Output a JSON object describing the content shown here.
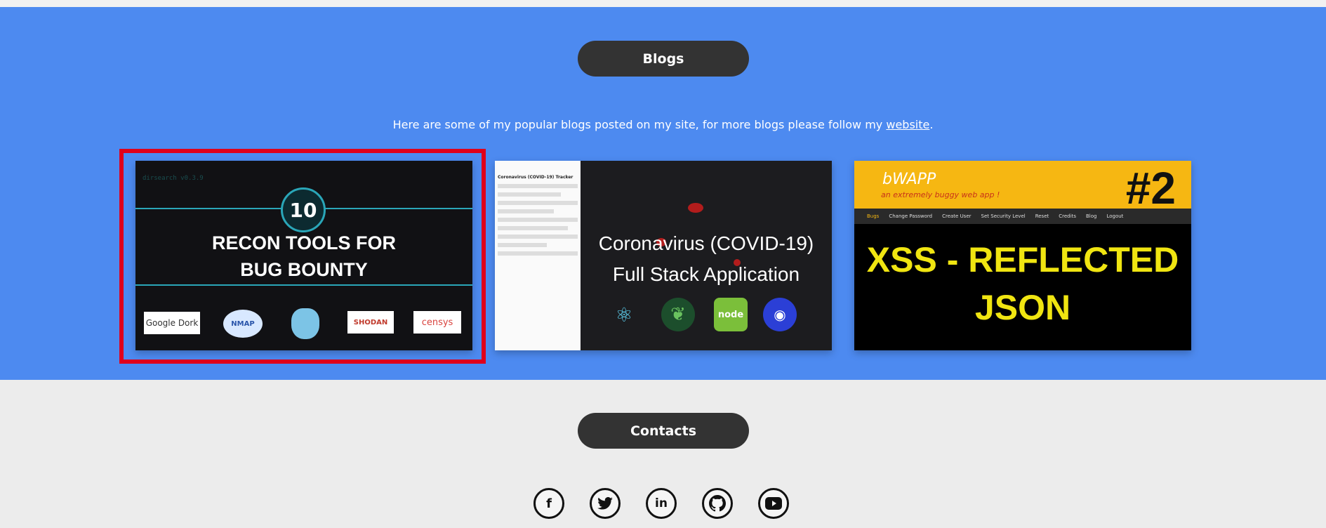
{
  "blogs_section": {
    "heading": "Blogs",
    "intro_text": "Here are some of my popular blogs posted on my site, for more blogs please follow my ",
    "intro_link": "website",
    "intro_end": "."
  },
  "cards": [
    {
      "terminal_header": "dirsearch v0.3.9",
      "number": "10",
      "title_line1": "RECON TOOLS FOR",
      "title_line2": "BUG BOUNTY",
      "logos": [
        "Google Dork",
        "NMAP",
        "SHODAN",
        "censys"
      ]
    },
    {
      "panel_title": "Coronavirus (COVID-19) Tracker",
      "title_line1": "Coronavirus (COVID-19)",
      "title_line2": "Full Stack Application",
      "tech": [
        "React",
        "MongoDB",
        "node",
        "Leaflet"
      ]
    },
    {
      "brand": "bWAPP",
      "tagline": "an extremely buggy web app !",
      "number": "#2",
      "menu": [
        "Bugs",
        "Change Password",
        "Create User",
        "Set Security Level",
        "Reset",
        "Credits",
        "Blog",
        "Logout"
      ],
      "title_line1": "XSS - REFLECTED",
      "title_line2": "JSON"
    }
  ],
  "contacts_section": {
    "heading": "Contacts",
    "social": [
      "facebook-icon",
      "twitter-icon",
      "linkedin-icon",
      "github-icon",
      "youtube-icon"
    ]
  },
  "colors": {
    "blue": "#4d8af0",
    "pill": "#333333",
    "selection": "#e0001b"
  }
}
